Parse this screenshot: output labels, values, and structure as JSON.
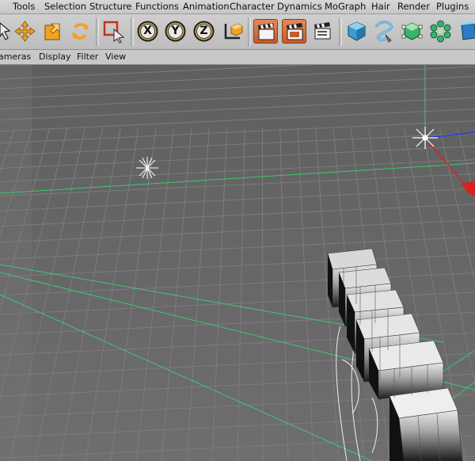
{
  "menubar": {
    "items": [
      "Tools",
      "Selection",
      "Structure",
      "Functions",
      "Animation",
      "Character",
      "Dynamics",
      "MoGraph",
      "Hair",
      "Render",
      "Plugins"
    ]
  },
  "toolbar": {
    "axis_x": "X",
    "axis_y": "Y",
    "axis_z": "Z"
  },
  "viewport_menu": {
    "items": [
      "ameras",
      "Display",
      "Filter",
      "View"
    ]
  },
  "colors": {
    "accent_orange": "#d4692f",
    "grid_line": "#7c7c7c",
    "axis_green": "#3cc874",
    "axis_red": "#d82222",
    "axis_blue": "#2a3fd8"
  }
}
